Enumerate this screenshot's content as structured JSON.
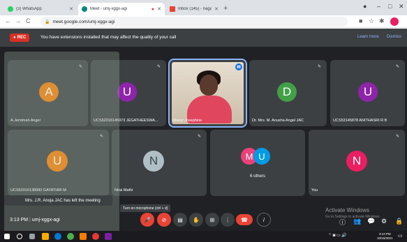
{
  "browser": {
    "tabs": [
      {
        "title": "(3) WhatsApp",
        "favicon_color": "#25d366",
        "active": false
      },
      {
        "title": "Meet - umj-xggx-agi",
        "favicon_color": "#00897b",
        "active": true
      },
      {
        "title": "Inbox (145) - nagaprhco@anna...",
        "favicon_color": "#ea4335",
        "active": false
      }
    ],
    "new_tab": "+",
    "window_controls": [
      "–",
      "□",
      "✕"
    ],
    "url": "meet.google.com/umj-xggx-agi",
    "nav": [
      "←",
      "→",
      "C",
      "⌂"
    ]
  },
  "meet": {
    "rec_label": "REC",
    "banner_text": "You have extensions installed that may affect the quality of your call",
    "learn_more": "Learn more",
    "dismiss": "Dismiss",
    "participants": [
      {
        "initial": "A",
        "name": "A.Jemimah Angel",
        "color": "#f57c00"
      },
      {
        "initial": "U",
        "name": "UCS52016145973 JEGATHEESWA...",
        "color": "#8e24aa"
      },
      {
        "initial": "",
        "name": "Sheryl Josephine",
        "color": "#e0475f"
      },
      {
        "initial": "D",
        "name": "Dr. Mrs. M. Anusha Angel JAC",
        "color": "#43a047"
      },
      {
        "initial": "U",
        "name": "UCS53145878 ANITHASRI R B",
        "color": "#8e24aa"
      },
      {
        "initial": "U",
        "name": "UCS52016138990 GAYATHRI M",
        "color": "#f57c00"
      },
      {
        "initial": "N",
        "name": "Nirai Mathi",
        "color": "#b0bec5"
      },
      {
        "initial": "N",
        "name": "You",
        "color": "#e91e63"
      }
    ],
    "others": {
      "initials": [
        "M",
        "U"
      ],
      "colors": [
        "#ec407a",
        "#039be5"
      ],
      "label": "6 others"
    },
    "toast": "Mrs. J.R. Anoja JAC has left the meeting",
    "time": "3:13 PM",
    "meeting_code": "umj-xggx-agi",
    "tooltip": "Turn on microphone (ctrl + d)",
    "activate_title": "Activate Windows",
    "activate_sub": "Go to Settings to activate Windows."
  },
  "taskbar": {
    "time": "3:13 PM",
    "date": "10/16/2021"
  }
}
